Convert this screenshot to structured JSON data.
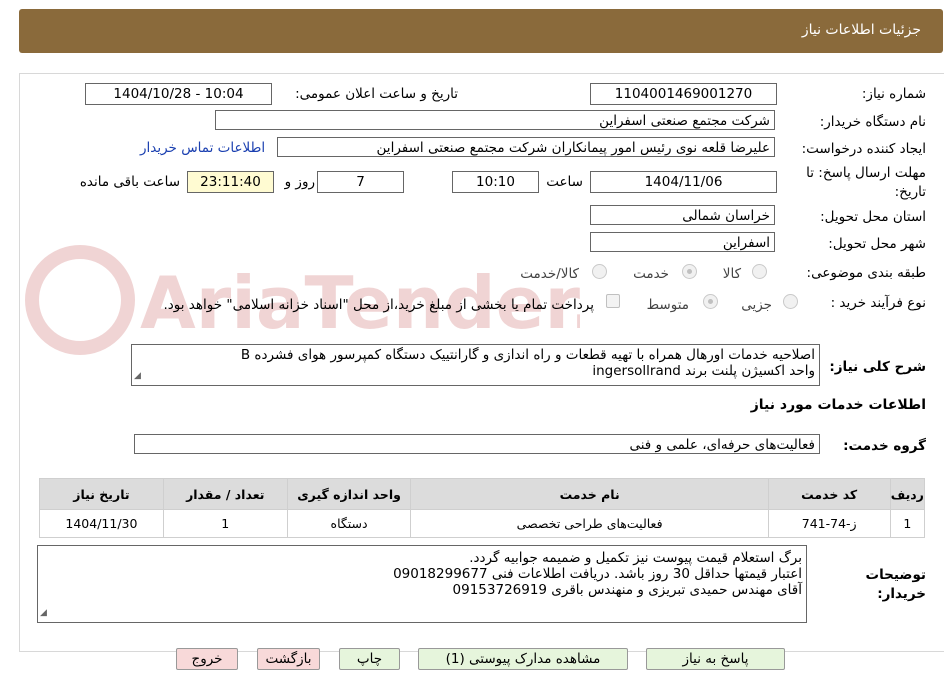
{
  "header": {
    "title": "جزئیات اطلاعات نیاز"
  },
  "watermark": {
    "text": "AriaTender.neT"
  },
  "fields": {
    "need_number_label": "شماره نیاز:",
    "need_number": "1104001469001270",
    "announce_label": "تاریخ و ساعت اعلان عمومی:",
    "announce_value": "1404/10/28 - 10:04",
    "buyer_org_label": "نام دستگاه خریدار:",
    "buyer_org": "شرکت مجتمع صنعتی اسفراین",
    "requester_label": "ایجاد کننده درخواست:",
    "requester": "علیرضا قلعه نوی رئیس امور پیمانکاران شرکت مجتمع صنعتی اسفراین",
    "contact_link": "اطلاعات تماس خریدار",
    "deadline_label_1": "مهلت ارسال پاسخ: تا",
    "deadline_label_2": "تاریخ:",
    "deadline_date": "1404/11/06",
    "time_label": "ساعت",
    "deadline_time": "10:10",
    "days_value": "7",
    "days_label": "روز و",
    "remaining_time": "23:11:40",
    "remaining_label": "ساعت باقی مانده",
    "province_label": "استان محل تحویل:",
    "province": "خراسان شمالی",
    "city_label": "شهر محل تحویل:",
    "city": "اسفراین",
    "category_label": "طبقه بندی موضوعی:",
    "category_options": [
      "کالا",
      "خدمت",
      "کالا/خدمت"
    ],
    "process_label": "نوع فرآیند خرید :",
    "process_options": [
      "جزیی",
      "متوسط"
    ],
    "payment_note": "پرداخت تمام یا بخشی از مبلغ خرید،از محل \"اسناد خزانه اسلامی\" خواهد بود."
  },
  "description": {
    "label": "شرح کلی نیاز:",
    "line1": "اصلاحیه خدمات اورهال همراه با تهیه قطعات و راه اندازی و گارانتییک دستگاه کمپرسور هوای فشرده B",
    "line2": "واحد اکسیژن پلنت برند ingersollrand"
  },
  "services": {
    "section_title": "اطلاعات خدمات مورد نیاز",
    "group_label": "گروه خدمت:",
    "group_value": "فعالیت‌های حرفه‌ای، علمی و فنی",
    "columns": [
      "ردیف",
      "کد خدمت",
      "نام خدمت",
      "واحد اندازه گیری",
      "تعداد / مقدار",
      "تاریخ نیاز"
    ],
    "rows": [
      [
        "1",
        "ز-74-741",
        "فعالیت‌های طراحی تخصصی",
        "دستگاه",
        "1",
        "1404/11/30"
      ]
    ]
  },
  "buyer_notes": {
    "label_1": "توضیحات",
    "label_2": "خریدار:",
    "line1": "برگ استعلام قیمت پیوست نیز تکمیل و ضمیمه جوابیه گردد.",
    "line2": "اعتبار قیمتها حداقل 30 روز باشد. دریافت اطلاعات فنی 09018299677",
    "line3": "آقای مهندس حمیدی تبریزی و منهندس باقری 09153726919"
  },
  "buttons": {
    "reply": "پاسخ به نیاز",
    "attachments": "مشاهده مدارک پیوستی (1)",
    "print": "چاپ",
    "back": "بازگشت",
    "exit": "خروج"
  }
}
